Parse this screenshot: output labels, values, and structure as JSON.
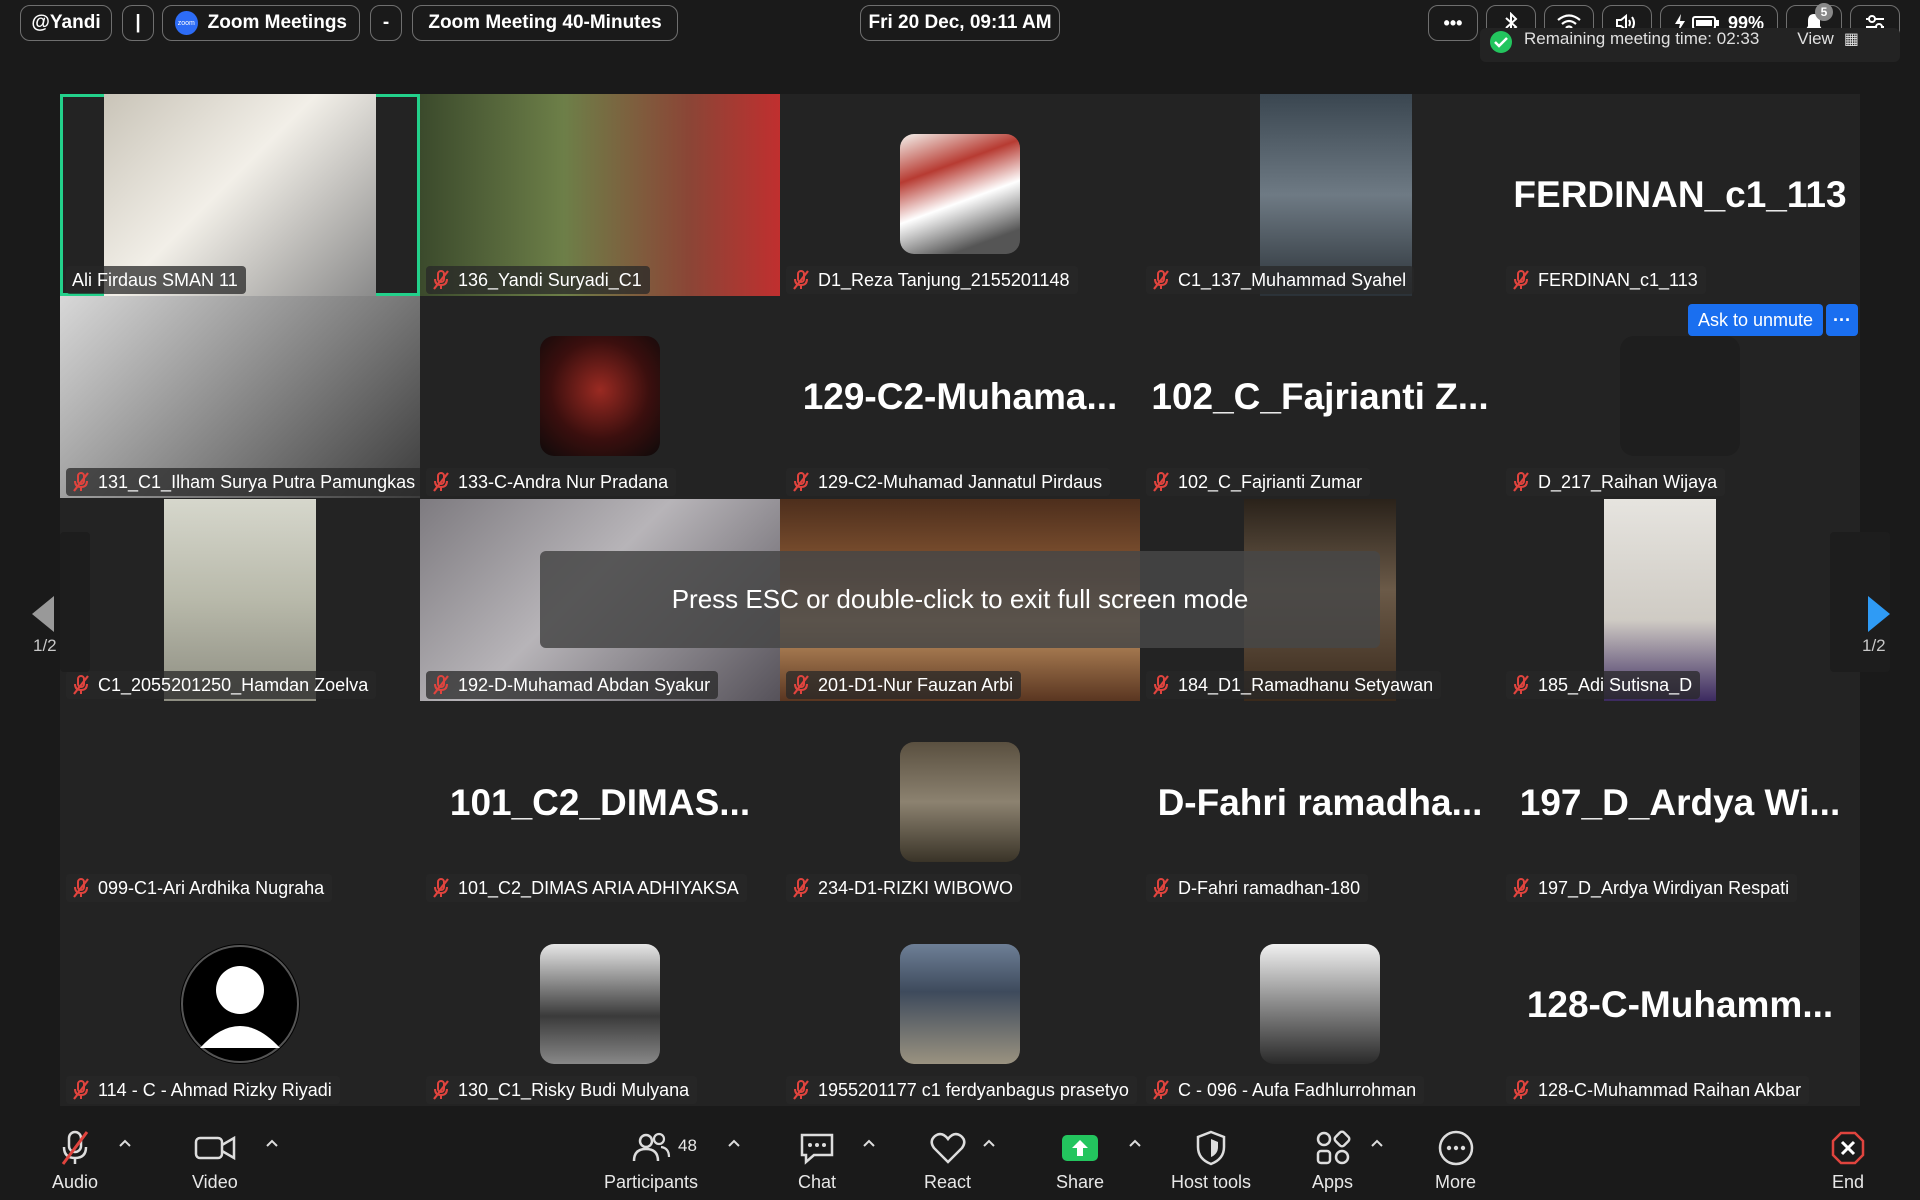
{
  "topbar": {
    "user": "@Yandi",
    "sep": "|",
    "app_title": "Zoom Meetings",
    "zoom_logo_text": "zoom",
    "dash": "-",
    "meeting_title": "Zoom Meeting 40-Minutes",
    "datetime": "Fri 20 Dec, 09:11 AM",
    "more": "•••",
    "battery": "99%",
    "notif_count": "5",
    "remaining": "Remaining meeting time: 02:33",
    "view": "View"
  },
  "participants": [
    {
      "name": "Ali Firdaus SMAN 11",
      "display": "",
      "type": "video",
      "muted": false,
      "active": true
    },
    {
      "name": "136_Yandi Suryadi_C1",
      "display": "",
      "type": "video",
      "muted": true
    },
    {
      "name": "D1_Reza Tanjung_2155201148",
      "display": "",
      "type": "avatar",
      "muted": true
    },
    {
      "name": "C1_137_Muhammad Syahel",
      "display": "",
      "type": "video",
      "muted": true
    },
    {
      "name": "FERDINAN_c1_113",
      "display": "FERDINAN_c1_113",
      "type": "name",
      "muted": true
    },
    {
      "name": "131_C1_Ilham Surya Putra Pamungkas",
      "display": "",
      "type": "video",
      "muted": true
    },
    {
      "name": "133-C-Andra Nur Pradana",
      "display": "",
      "type": "avatar",
      "muted": true
    },
    {
      "name": "129-C2-Muhamad Jannatul Pirdaus",
      "display": "129-C2-Muhama...",
      "type": "name",
      "muted": true
    },
    {
      "name": "102_C_Fajrianti Zumar",
      "display": "102_C_Fajrianti  Z...",
      "type": "name",
      "muted": true
    },
    {
      "name": "D_217_Raihan Wijaya",
      "display": "",
      "type": "avatar",
      "muted": true
    },
    {
      "name": "C1_2055201250_Hamdan Zoelva",
      "display": "",
      "type": "video",
      "muted": true
    },
    {
      "name": "192-D-Muhamad Abdan Syakur",
      "display": "",
      "type": "video",
      "muted": true
    },
    {
      "name": "201-D1-Nur Fauzan Arbi",
      "display": "",
      "type": "video",
      "muted": true
    },
    {
      "name": "184_D1_Ramadhanu Setyawan",
      "display": "",
      "type": "video",
      "muted": true
    },
    {
      "name": "185_Adi Sutisna_D",
      "display": "",
      "type": "video",
      "muted": true
    },
    {
      "name": "099-C1-Ari Ardhika Nugraha",
      "display": "",
      "type": "blank",
      "muted": true
    },
    {
      "name": "101_C2_DIMAS ARIA ADHIYAKSA",
      "display": "101_C2_DIMAS...",
      "type": "name",
      "muted": true
    },
    {
      "name": "234-D1-RIZKI WIBOWO",
      "display": "",
      "type": "avatar",
      "muted": true
    },
    {
      "name": "D-Fahri ramadhan-180",
      "display": "D-Fahri  ramadha...",
      "type": "name",
      "muted": true
    },
    {
      "name": "197_D_Ardya Wirdiyan Respati",
      "display": "197_D_Ardya  Wi...",
      "type": "name",
      "muted": true
    },
    {
      "name": "114 - C - Ahmad Rizky Riyadi",
      "display": "",
      "type": "avatar",
      "muted": true
    },
    {
      "name": "130_C1_Risky Budi Mulyana",
      "display": "",
      "type": "avatar",
      "muted": true
    },
    {
      "name": "1955201177 c1 ferdyanbagus prasetyo",
      "display": "",
      "type": "avatar",
      "muted": true
    },
    {
      "name": "C - 096 - Aufa Fadhlurrohman",
      "display": "",
      "type": "avatar",
      "muted": true
    },
    {
      "name": "128-C-Muhammad Raihan Akbar",
      "display": "128-C-Muhamm...",
      "type": "name",
      "muted": true
    }
  ],
  "overlay": {
    "fullscreen_msg": "Press ESC or double-click to exit full screen mode",
    "ask_unmute": "Ask to unmute",
    "ask_more": "···",
    "page_left": "1/2",
    "page_right": "1/2"
  },
  "toolbar": {
    "audio": "Audio",
    "video": "Video",
    "participants": "Participants",
    "participants_count": "48",
    "chat": "Chat",
    "react": "React",
    "share": "Share",
    "host_tools": "Host tools",
    "apps": "Apps",
    "more": "More",
    "end": "End"
  },
  "colors": {
    "accent": "#1a6ff0",
    "active_border": "#23d18b",
    "muted": "#e0443e",
    "share": "#23c55e",
    "end": "#e0443e"
  }
}
